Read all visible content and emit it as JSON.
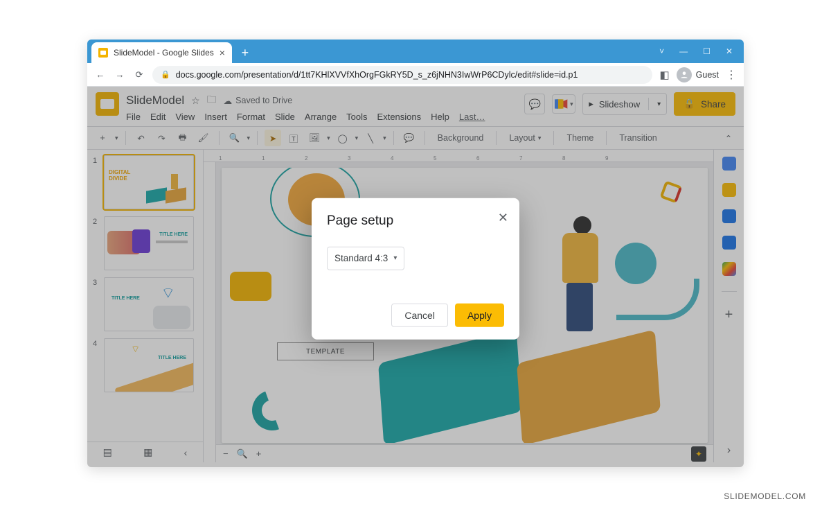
{
  "browser": {
    "tab_title": "SlideModel - Google Slides",
    "url": "docs.google.com/presentation/d/1tt7KHlXVVfXhOrgFGkRY5D_s_z6jNHN3IwWrP6CDylc/edit#slide=id.p1",
    "guest_label": "Guest"
  },
  "header": {
    "doc_title": "SlideModel",
    "saved_status": "Saved to Drive",
    "menus": [
      "File",
      "Edit",
      "View",
      "Insert",
      "Format",
      "Slide",
      "Arrange",
      "Tools",
      "Extensions",
      "Help",
      "Last…"
    ],
    "slideshow_label": "Slideshow",
    "share_label": "Share"
  },
  "toolbar": {
    "background": "Background",
    "layout": "Layout",
    "theme": "Theme",
    "transition": "Transition"
  },
  "thumbnails": [
    {
      "num": "1",
      "title_line1": "DIGITAL",
      "title_line2": "DIVIDE"
    },
    {
      "num": "2",
      "title": "TITLE HERE"
    },
    {
      "num": "3",
      "title": "TITLE HERE"
    },
    {
      "num": "4",
      "title": "TITLE HERE"
    }
  ],
  "slide": {
    "template_label": "TEMPLATE"
  },
  "modal": {
    "title": "Page setup",
    "dropdown_value": "Standard 4:3",
    "cancel": "Cancel",
    "apply": "Apply"
  },
  "watermark": "SLIDEMODEL.COM"
}
